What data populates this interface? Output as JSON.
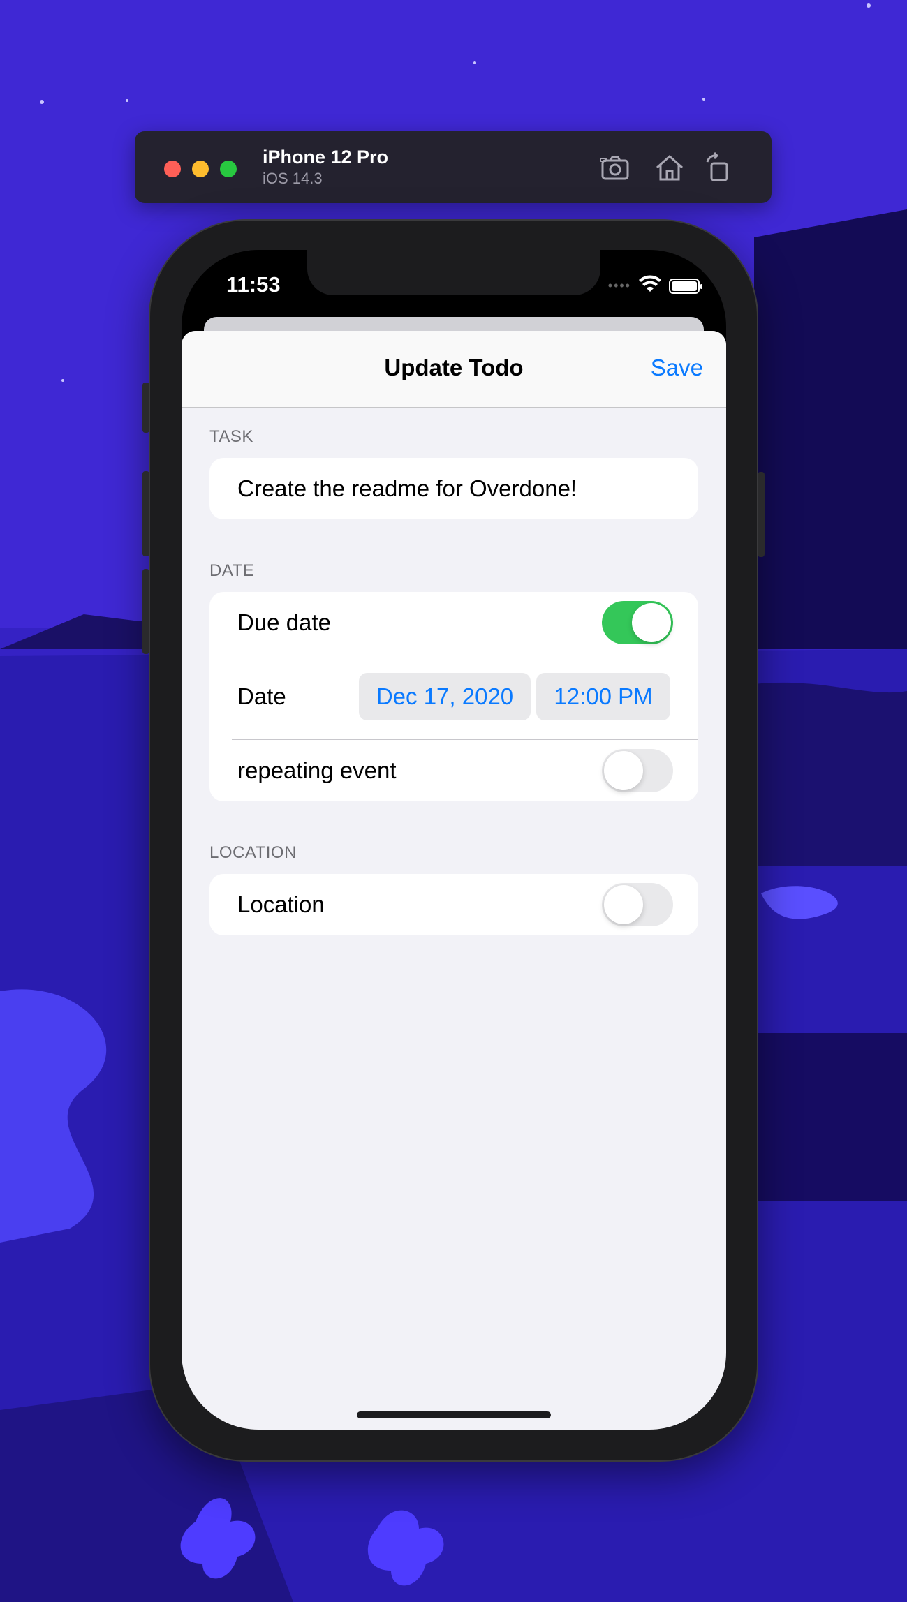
{
  "simulator": {
    "device_name": "iPhone 12 Pro",
    "os_version": "iOS 14.3",
    "toolbar_icons": [
      "screenshot-icon",
      "home-icon",
      "rotate-icon"
    ]
  },
  "status_bar": {
    "time": "11:53",
    "icons": [
      "signal-dots-icon",
      "wifi-icon",
      "battery-icon"
    ]
  },
  "nav": {
    "title": "Update Todo",
    "save_label": "Save"
  },
  "task_section": {
    "header": "TASK",
    "value": "Create the readme for Overdone!"
  },
  "date_section": {
    "header": "DATE",
    "due_date_label": "Due date",
    "due_date_on": true,
    "date_label": "Date",
    "date_value": "Dec 17, 2020",
    "time_value": "12:00 PM",
    "repeating_label": "repeating event",
    "repeating_on": false
  },
  "location_section": {
    "header": "LOCATION",
    "location_label": "Location",
    "location_on": false
  },
  "colors": {
    "accent": "#0a7aff",
    "toggle_on": "#34c759",
    "background": "#3d28d6"
  }
}
